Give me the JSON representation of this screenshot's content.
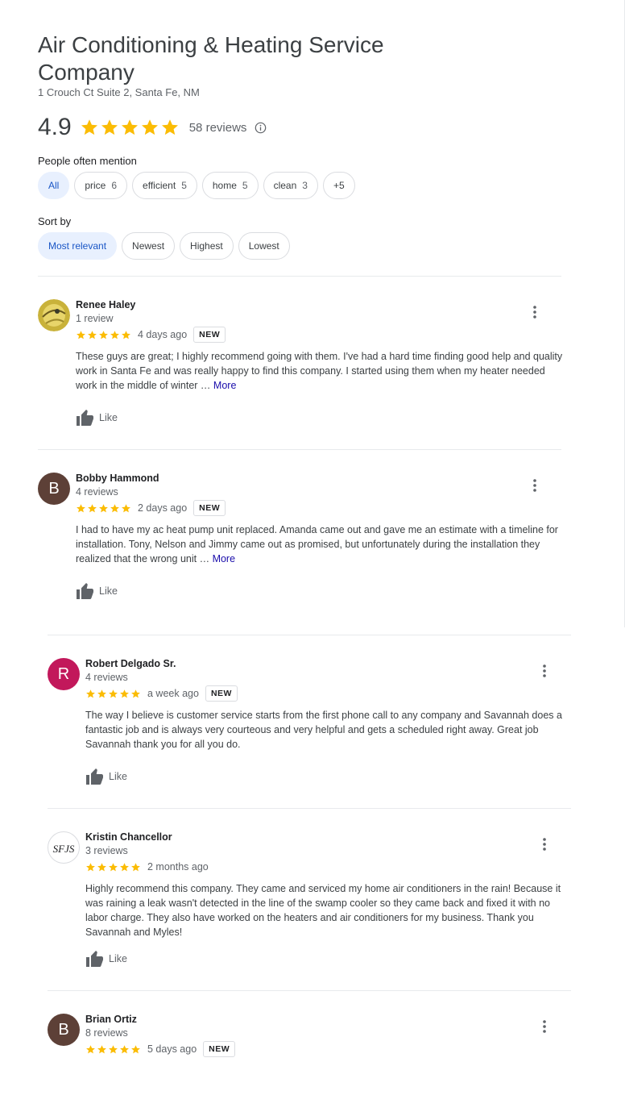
{
  "business": {
    "name": "Air Conditioning & Heating Service Company",
    "address": "1 Crouch Ct Suite 2, Santa Fe, NM",
    "rating": "4.9",
    "reviews_label": "58 reviews",
    "star_rating_value": 5
  },
  "mentions": {
    "label": "People often mention",
    "chips": [
      {
        "label": "All",
        "count": ""
      },
      {
        "label": "price",
        "count": "6"
      },
      {
        "label": "efficient",
        "count": "5"
      },
      {
        "label": "home",
        "count": "5"
      },
      {
        "label": "clean",
        "count": "3"
      },
      {
        "label": "+5",
        "count": ""
      }
    ]
  },
  "sort": {
    "label": "Sort by",
    "options": [
      "Most relevant",
      "Newest",
      "Highest",
      "Lowest"
    ]
  },
  "colors": {
    "star": "#fbbc04",
    "accent": "#1a56c6",
    "selected_chip_bg": "#e8f0fe",
    "link": "#1a0dab"
  },
  "reviews": [
    {
      "name": "Renee Haley",
      "count": "1 review",
      "stars": 5,
      "date": "4 days ago",
      "badge": "NEW",
      "text": "These guys are great; I highly recommend going with them. I've had a hard time finding good help and quality work in Santa Fe and was really happy to find this company. I started using them when my heater needed work in the middle of winter …",
      "more": "More",
      "like": "Like",
      "avatar_letter": "",
      "avatar_icon": "photo-avatar"
    },
    {
      "name": "Bobby Hammond",
      "count": "4 reviews",
      "stars": 5,
      "date": "2 days ago",
      "badge": "NEW",
      "text": "I had to have my ac heat pump unit replaced. Amanda came out and gave me an estimate with a timeline for installation. Tony, Nelson and Jimmy came out as promised, but unfortunately during the installation they realized that the wrong unit …",
      "more": "More",
      "like": "Like",
      "avatar_letter": "B",
      "avatar_color": "#5d4037"
    },
    {
      "name": "Robert Delgado Sr.",
      "count": "4 reviews",
      "stars": 5,
      "date": "a week ago",
      "badge": "NEW",
      "text": "The way I believe is customer service starts from the first phone call to any company and Savannah does a fantastic job and is always very courteous and very helpful and gets a scheduled right away. Great job Savannah thank you for all you do.",
      "more": "",
      "like": "Like",
      "avatar_letter": "R",
      "avatar_color": "#c2185b"
    },
    {
      "name": "Kristin Chancellor",
      "count": "3 reviews",
      "stars": 5,
      "date": "2 months ago",
      "badge": "",
      "text": "Highly recommend this company. They came and serviced my home air conditioners in the rain! Because it was raining a leak wasn't detected in the line of the swamp cooler so they came back and fixed it with no labor charge. They also have worked on the heaters and air conditioners for my business. Thank you Savannah and Myles!",
      "more": "",
      "like": "Like",
      "avatar_letter": "",
      "avatar_icon": "monogram-avatar",
      "avatar_logo_text": "SFJS"
    },
    {
      "name": "Brian Ortiz",
      "count": "8 reviews",
      "stars": 5,
      "date": "5 days ago",
      "badge": "NEW",
      "text": "",
      "more": "",
      "like": "",
      "avatar_letter": "B",
      "avatar_color": "#5d4037"
    }
  ]
}
